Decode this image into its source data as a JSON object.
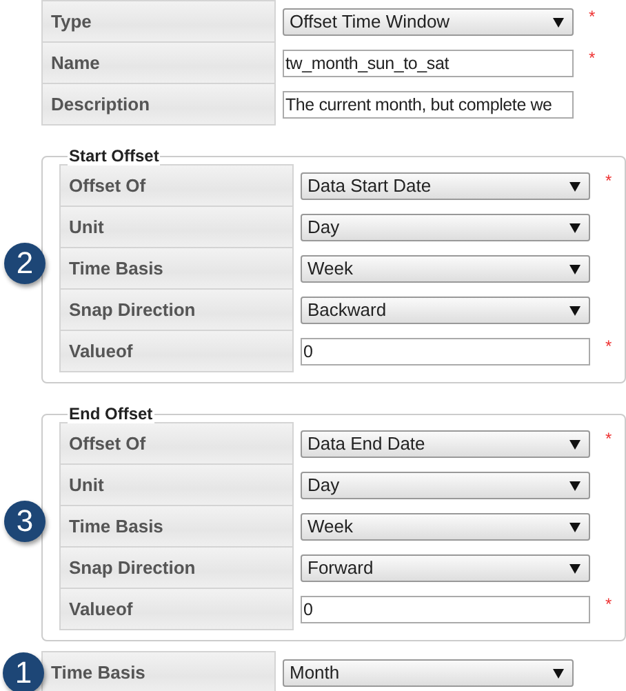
{
  "fields": [
    {
      "label": "Type",
      "kind": "select",
      "value": "Offset Time Window",
      "required_mark": "*"
    },
    {
      "label": "Name",
      "kind": "text",
      "value": "tw_month_sun_to_sat",
      "required_mark": "*"
    },
    {
      "label": "Description",
      "kind": "text",
      "value": "The current month, but complete we"
    }
  ],
  "sections": [
    {
      "legend": "Start Offset",
      "badge": "2",
      "fields": [
        {
          "label": "Offset Of",
          "kind": "select",
          "value": "Data Start Date",
          "required_mark": "*"
        },
        {
          "label": "Unit",
          "kind": "select",
          "value": "Day"
        },
        {
          "label": "Time Basis",
          "kind": "select",
          "value": "Week"
        },
        {
          "label": "Snap Direction",
          "kind": "select",
          "value": "Backward"
        },
        {
          "label": "Valueof",
          "kind": "text",
          "value": "0",
          "required_mark": "*"
        }
      ]
    },
    {
      "legend": "End Offset",
      "badge": "3",
      "fields": [
        {
          "label": "Offset Of",
          "kind": "select",
          "value": "Data End Date",
          "required_mark": "*"
        },
        {
          "label": "Unit",
          "kind": "select",
          "value": "Day"
        },
        {
          "label": "Time Basis",
          "kind": "select",
          "value": "Week"
        },
        {
          "label": "Snap Direction",
          "kind": "select",
          "value": "Forward"
        },
        {
          "label": "Valueof",
          "kind": "text",
          "value": "0",
          "required_mark": "*"
        }
      ]
    }
  ],
  "footer": {
    "badge": "1",
    "fields": [
      {
        "label": "Time Basis",
        "kind": "select",
        "value": "Month"
      }
    ]
  }
}
